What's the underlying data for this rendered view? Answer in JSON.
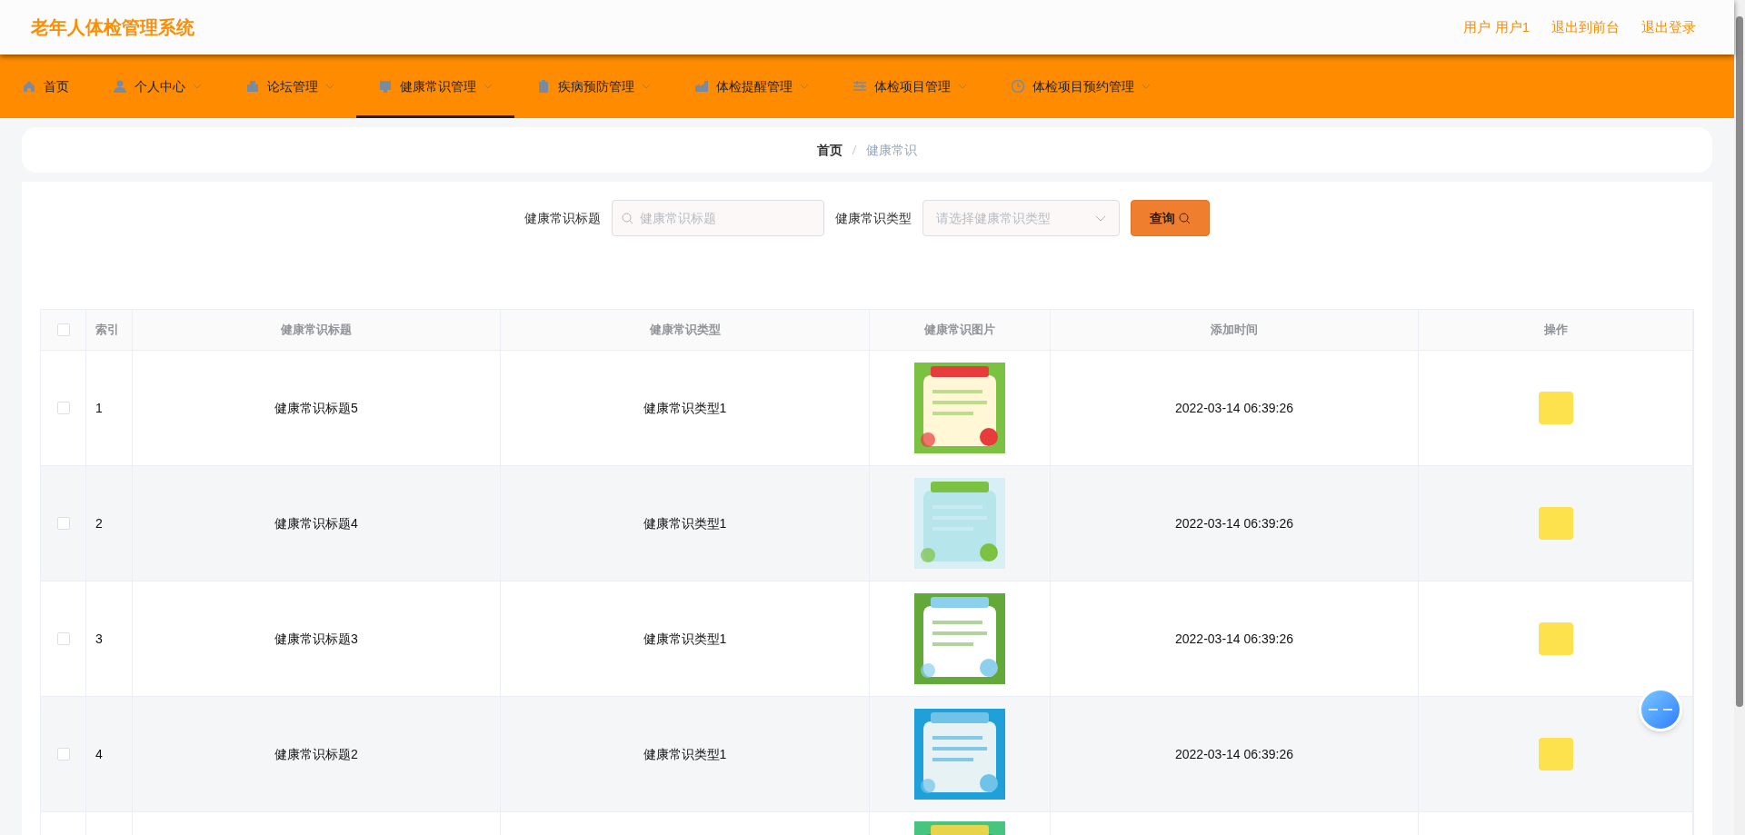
{
  "header": {
    "title": "老年人体检管理系统",
    "links": [
      "用户 用户1",
      "退出到前台",
      "退出登录"
    ]
  },
  "nav": [
    {
      "label": "首页",
      "selected": false
    },
    {
      "label": "个人中心",
      "selected": false
    },
    {
      "label": "论坛管理",
      "selected": false
    },
    {
      "label": "健康常识管理",
      "selected": true
    },
    {
      "label": "疾病预防管理",
      "selected": false
    },
    {
      "label": "体检提醒管理",
      "selected": false
    },
    {
      "label": "体检项目管理",
      "selected": false
    },
    {
      "label": "体检项目预约管理",
      "selected": false
    }
  ],
  "breadcrumb": [
    "首页",
    "健康常识"
  ],
  "search": {
    "title_label": "健康常识标题",
    "title_placeholder": "健康常识标题",
    "type_label": "健康常识类型",
    "type_placeholder": "请选择健康常识类型",
    "button": "查询"
  },
  "table": {
    "all_checked": false,
    "columns": [
      "索引",
      "健康常识标题",
      "健康常识类型",
      "健康常识图片",
      "添加时间",
      "操作"
    ],
    "rows": [
      {
        "index": "1",
        "title": "健康常识标题5",
        "type": "健康常识类型1",
        "time": "2022-03-14 06:39:26",
        "checked": false
      },
      {
        "index": "2",
        "title": "健康常识标题4",
        "type": "健康常识类型1",
        "time": "2022-03-14 06:39:26",
        "checked": false
      },
      {
        "index": "3",
        "title": "健康常识标题3",
        "type": "健康常识类型1",
        "time": "2022-03-14 06:39:26",
        "checked": false
      },
      {
        "index": "4",
        "title": "健康常识标题2",
        "type": "健康常识类型1",
        "time": "2022-03-14 06:39:26",
        "checked": false
      }
    ]
  }
}
